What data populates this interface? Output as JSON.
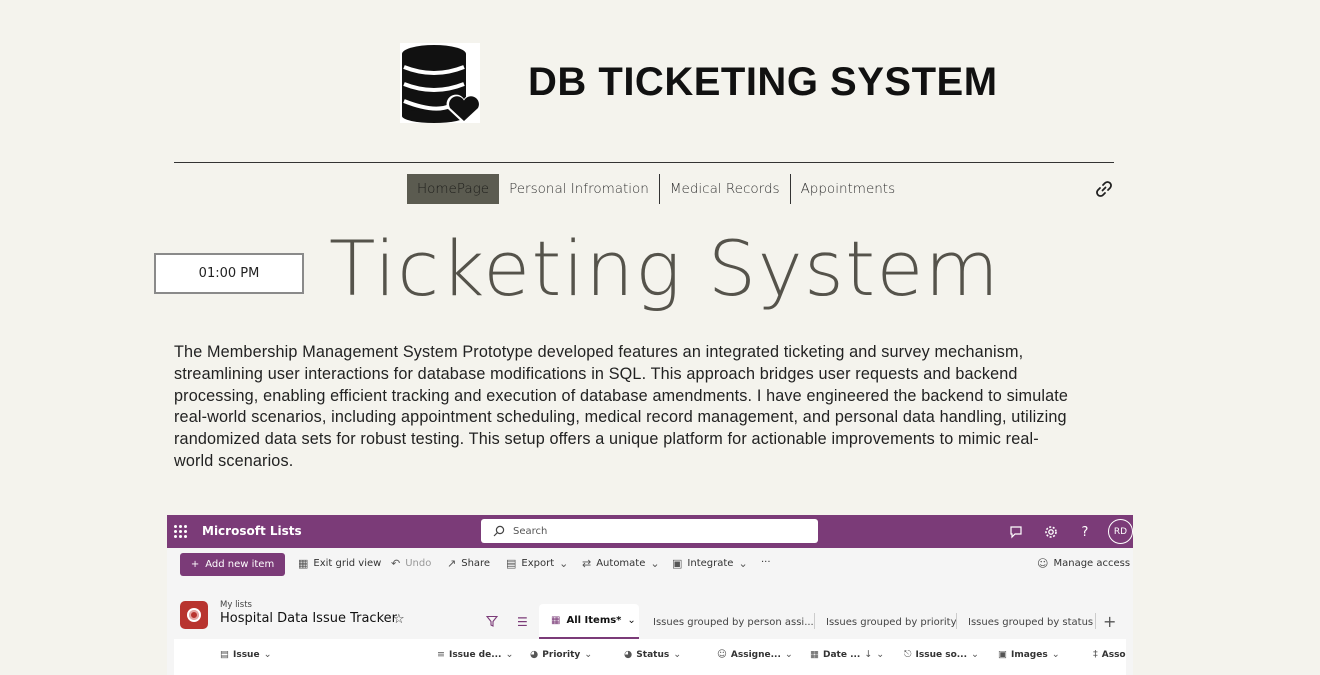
{
  "site": {
    "title": "DB TICKETING SYSTEM",
    "logo_icon": "database-heart-icon"
  },
  "nav": {
    "items": [
      {
        "label": "HomePage",
        "active": true
      },
      {
        "label": "Personal Infromation",
        "active": false
      },
      {
        "label": "Medical Records",
        "active": false
      },
      {
        "label": "Appointments",
        "active": false
      }
    ],
    "link_icon": "link-icon"
  },
  "time": "01:00 PM",
  "hero": "Ticketing System",
  "description": "The Membership Management System Prototype developed features an integrated ticketing and survey mechanism, streamlining user interactions for database modifications in SQL. This approach bridges user requests and backend processing, enabling efficient tracking and execution of database amendments. I have engineered the backend to simulate real-world scenarios, including appointment scheduling, medical record management, and personal data handling, utilizing randomized data sets for robust testing. This setup offers a unique platform for actionable improvements to mimic real-world scenarios.",
  "ms_lists": {
    "accent": "#7b3b78",
    "app_name": "Microsoft Lists",
    "search_placeholder": "Search",
    "avatar": "RD",
    "commands": {
      "add": "Add new item",
      "exit_grid": "Exit grid view",
      "undo": "Undo",
      "share": "Share",
      "export": "Export",
      "automate": "Automate",
      "integrate": "Integrate",
      "more": "···",
      "manage_access": "Manage access"
    },
    "breadcrumb": "My lists",
    "list_title": "Hospital Data Issue Tracker",
    "views": {
      "active": "All Items*",
      "others": [
        "Issues grouped by person assi...",
        "Issues grouped by priority",
        "Issues grouped by status"
      ]
    },
    "columns": [
      "Issue",
      "Issue de...",
      "Priority",
      "Status",
      "Assigne...",
      "Date ...",
      "Issue so...",
      "Images",
      "Asso"
    ]
  }
}
